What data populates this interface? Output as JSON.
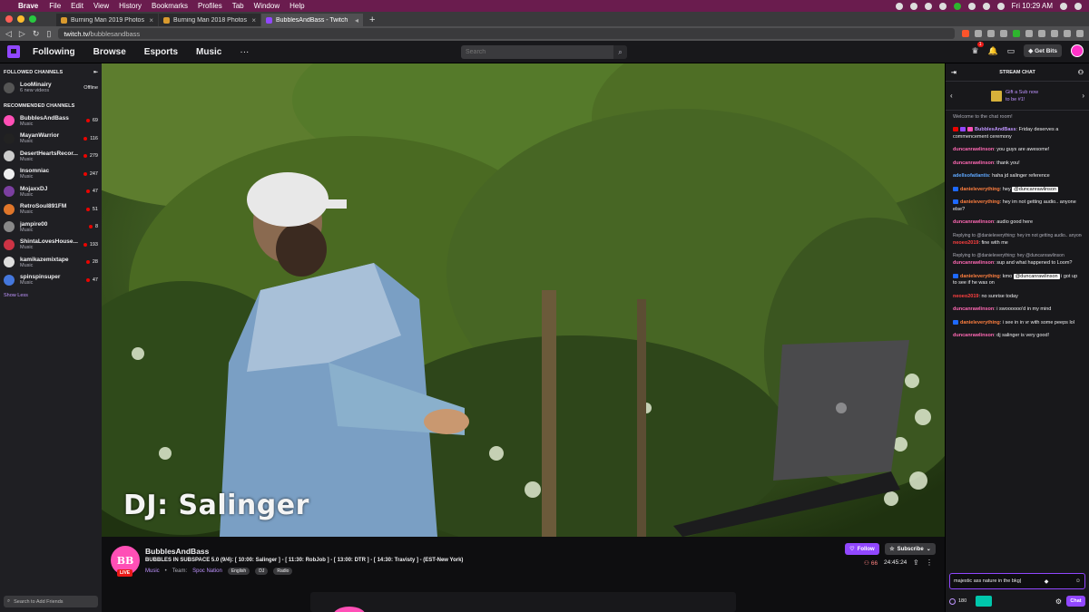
{
  "menubar": {
    "app_name": "Brave",
    "items": [
      "File",
      "Edit",
      "View",
      "History",
      "Bookmarks",
      "Profiles",
      "Tab",
      "Window",
      "Help"
    ],
    "clock": "Fri 10:29 AM"
  },
  "tabs": [
    {
      "title": "Burning Man 2019 Photos - Bur",
      "active": false
    },
    {
      "title": "Burning Man 2018 Photos - Bur",
      "active": false
    },
    {
      "title": "BubblesAndBass - Twitch",
      "active": true
    }
  ],
  "address": {
    "host": "twitch.tv/",
    "path": "bubblesandbass"
  },
  "topnav": {
    "links": [
      "Following",
      "Browse",
      "Esports",
      "Music"
    ],
    "more": "···",
    "search_placeholder": "Search",
    "notifications_count": "1",
    "get_bits": "Get Bits"
  },
  "sidebar": {
    "followed_header": "FOLLOWED CHANNELS",
    "followed": [
      {
        "name": "LooMinairy",
        "sub": "6 new videos",
        "status": "Offline",
        "color": "#555555"
      }
    ],
    "recommended_header": "RECOMMENDED CHANNELS",
    "recommended": [
      {
        "name": "BubblesAndBass",
        "game": "Music",
        "viewers": "69",
        "color": "#ff4fb6"
      },
      {
        "name": "MayanWarrior",
        "game": "Music",
        "viewers": "116",
        "color": "#222222"
      },
      {
        "name": "DesertHeartsRecor...",
        "game": "Music",
        "viewers": "279",
        "color": "#cccccc"
      },
      {
        "name": "Insomniac",
        "game": "Music",
        "viewers": "247",
        "color": "#eeeeee"
      },
      {
        "name": "MojaxxDJ",
        "game": "Music",
        "viewers": "47",
        "color": "#7b3fa0"
      },
      {
        "name": "RetroSoul891FM",
        "game": "Music",
        "viewers": "51",
        "color": "#e0762a"
      },
      {
        "name": "jampire00",
        "game": "Music",
        "viewers": "8",
        "color": "#888888"
      },
      {
        "name": "ShintaLovesHouse...",
        "game": "Music",
        "viewers": "193",
        "color": "#cc3344"
      },
      {
        "name": "kamikazemixtape",
        "game": "Music",
        "viewers": "28",
        "color": "#dddddd"
      },
      {
        "name": "spinspinsuper",
        "game": "Music",
        "viewers": "47",
        "color": "#4477dd"
      }
    ],
    "show_less": "Show Less",
    "add_friends": "Search to Add Friends"
  },
  "video": {
    "overlay_text": "DJ: Salinger"
  },
  "channel": {
    "avatar_text": "BB",
    "live": "LIVE",
    "name": "BubblesAndBass",
    "title": "BUBBLES IN SUBSPACE 5.0 (9/4): [ 10:00: Salinger ] - [ 11:30: RobJob ] - [ 13:00: DTR ] - [ 14:30: Travisty ] - (EST-New York)",
    "category": "Music",
    "team_label": "Team:",
    "team": "Spoc Nation",
    "tags": [
      "English",
      "DJ",
      "Radio"
    ],
    "follow": "Follow",
    "subscribe": "Subscribe",
    "viewers": "66",
    "uptime": "24:45:24"
  },
  "chat": {
    "header": "STREAM CHAT",
    "gift_text": "Gift a Sub now to be #1!",
    "welcome": "Welcome to the chat room!",
    "messages": [
      {
        "user": "BubblesAndBass",
        "color": "#bf94ff",
        "text": ": Friday deserves a commencement ceremony",
        "badges": [
          "red",
          "purple",
          "pink"
        ]
      },
      {
        "user": "duncanrawlinson",
        "color": "#ff69b4",
        "text": ": you guys are awesome!",
        "badges": []
      },
      {
        "user": "duncanrawlinson",
        "color": "#ff69b4",
        "text": ": thank you!",
        "badges": []
      },
      {
        "user": "adellsofatlantis",
        "color": "#5fa8ff",
        "text": ": haha jd salinger reference",
        "badges": []
      },
      {
        "user": "danieleverything",
        "color": "#ff7f3f",
        "text": ": hey ",
        "mention": "@duncanrawlinson",
        "badges": [
          "blue"
        ]
      },
      {
        "user": "danieleverything",
        "color": "#ff7f3f",
        "text": ": hey im not getting audio.. anyone else?",
        "badges": [
          "blue"
        ]
      },
      {
        "user": "duncanrawlinson",
        "color": "#ff69b4",
        "text": ": audio good here",
        "badges": []
      },
      {
        "reply": "Replying to @danieleverything: hey im not getting audio.. anyone e...",
        "user": "neoeo2019",
        "color": "#ff4040",
        "text": ": fine with me",
        "badges": []
      },
      {
        "reply": "Replying to @danieleverything: hey @duncanrawlinson",
        "user": "duncanrawlinson",
        "color": "#ff69b4",
        "text": ": sup and what happened to Loom?",
        "badges": []
      },
      {
        "user": "danieleverything",
        "color": "#ff7f3f",
        "text": ": kmo ",
        "mention": "@duncanrawlinson",
        "after": " i got up to see if he was on",
        "badges": [
          "blue"
        ]
      },
      {
        "user": "neoeo2019",
        "color": "#ff4040",
        "text": ": no sunrise today",
        "badges": []
      },
      {
        "user": "duncanrawlinson",
        "color": "#ff69b4",
        "text": ": i swoooooo'd in my mind",
        "badges": []
      },
      {
        "user": "danieleverything",
        "color": "#ff7f3f",
        "text": ": i see in in vr with some peeps lol",
        "badges": [
          "blue"
        ]
      },
      {
        "user": "duncanrawlinson",
        "color": "#ff69b4",
        "text": ": dj salinger is very good!",
        "badges": []
      }
    ],
    "input_value": "majestic ass nature in the bkg|",
    "points": "180",
    "chat_button": "Chat"
  },
  "colors": {
    "accent": "#9147ff",
    "live_red": "#eb0400",
    "menubar": "#6a1c4e"
  }
}
